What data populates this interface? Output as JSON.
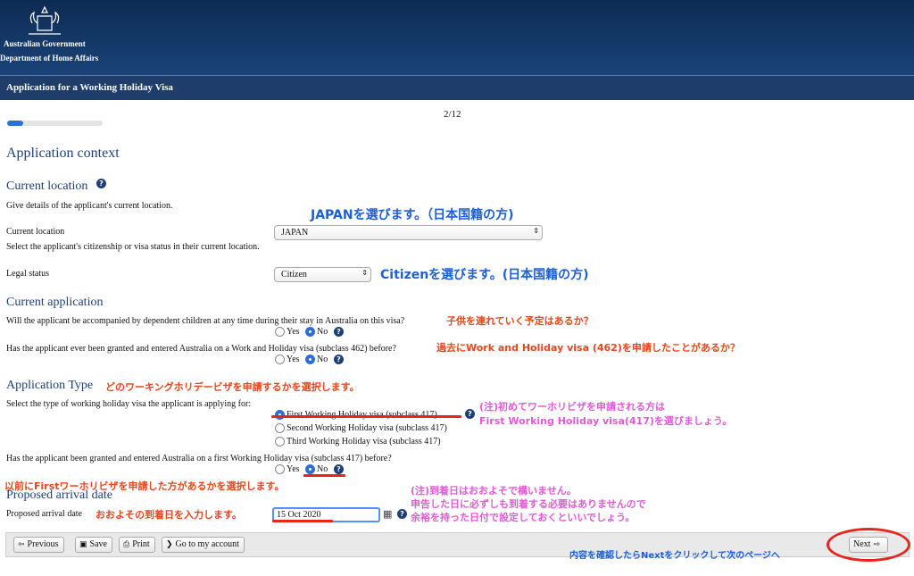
{
  "header": {
    "gov_line1": "Australian Government",
    "gov_line2": "Department of Home Affairs",
    "title": "Application for a Working Holiday Visa"
  },
  "progress": {
    "page": "2/12",
    "fraction": 0.17
  },
  "page_title": "Application context",
  "current_location": {
    "heading": "Current location",
    "intro": "Give details of the applicant's current location.",
    "location_label": "Current location",
    "location_value": "JAPAN",
    "location_hint": "Select the applicant's citizenship or visa status in their current location.",
    "legal_label": "Legal status",
    "legal_value": "Citizen"
  },
  "current_application": {
    "heading": "Current application",
    "q1": "Will the applicant be accompanied by dependent children at any time during their stay in Australia on this visa?",
    "q2": "Has the applicant ever been granted and entered Australia on a Work and Holiday visa (subclass 462) before?",
    "yes": "Yes",
    "no": "No"
  },
  "application_type": {
    "heading": "Application Type",
    "question": "Select the type of working holiday visa the applicant is applying for:",
    "options": [
      "First Working Holiday visa (subclass 417)",
      "Second Working Holiday visa (subclass 417)",
      "Third Working Holiday visa (subclass 417)"
    ],
    "q_prior": "Has the applicant been granted and entered Australia on a first Working Holiday visa (subclass 417) before?"
  },
  "arrival": {
    "heading": "Proposed arrival date",
    "label": "Proposed arrival date",
    "value": "15 Oct 2020"
  },
  "footer": {
    "previous": "Previous",
    "save": "Save",
    "print": "Print",
    "account": "Go to my account",
    "next": "Next"
  },
  "notes": {
    "japan": "JAPANを選びます。（日本国籍の方)",
    "citizen": "Citizenを選びます。(日本国籍の方)",
    "children": "子供を連れていく予定はあるか？",
    "past462": "過去にWork and Holiday visa (462)を申請したことがあるか？",
    "which_type": "どのワーキングホリデービザを申請するかを選択します。",
    "first_1": "(注)初めてワーホリビザを申請される方は",
    "first_2": "First Working Holiday visa(417)を選びましょう。",
    "prior": "以前にFirstワーホリビザを申請した方があるかを選択します。",
    "date_1": "(注)到着日はおおよそで構いません。",
    "date_2": "申告した日に必ずしも到着する必要はありませんので",
    "date_3": "余裕を持った日付で設定しておくといいでしょう。",
    "date_input": "おおよその到着日を入力します。",
    "next": "内容を確認したらNextをクリックして次のページへ"
  },
  "colors": {
    "header": "#0d2b52",
    "heading": "#1f3f77",
    "note_blue": "#1d5fd6",
    "note_red": "#e8461c",
    "note_pink": "#e25bd6",
    "radio_on": "#2c6fd6"
  }
}
